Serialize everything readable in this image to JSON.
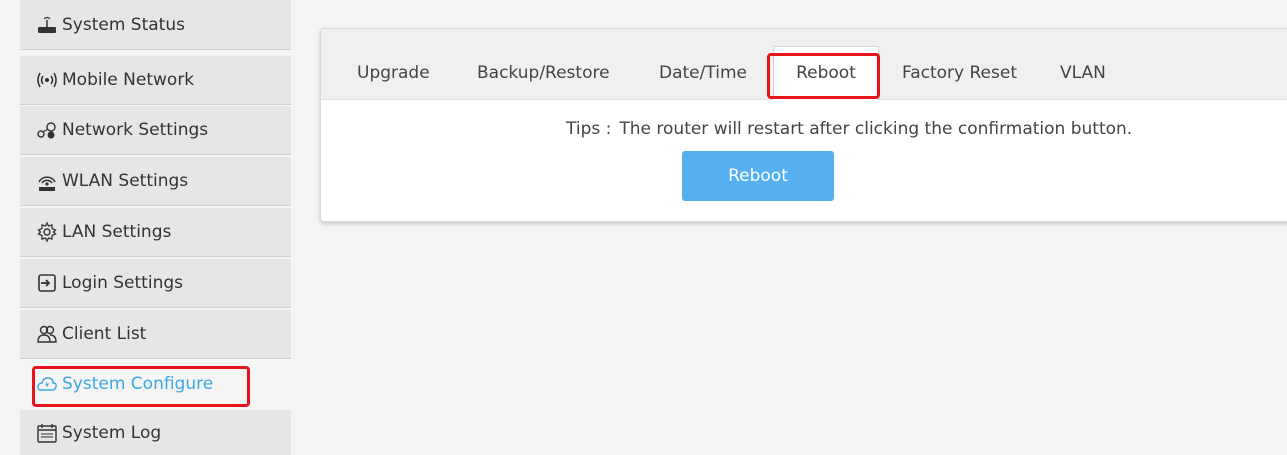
{
  "sidebar": {
    "items": [
      {
        "label": "System Status",
        "icon": "router-icon"
      },
      {
        "label": "Mobile Network",
        "icon": "signal-icon"
      },
      {
        "label": "Network Settings",
        "icon": "network-icon"
      },
      {
        "label": "WLAN Settings",
        "icon": "wifi-icon"
      },
      {
        "label": "LAN Settings",
        "icon": "gear-icon"
      },
      {
        "label": "Login Settings",
        "icon": "login-icon"
      },
      {
        "label": "Client List",
        "icon": "users-icon"
      },
      {
        "label": "System Configure",
        "icon": "cloud-icon",
        "active": true
      },
      {
        "label": "System Log",
        "icon": "calendar-icon"
      }
    ]
  },
  "tabs": [
    {
      "label": "Upgrade"
    },
    {
      "label": "Backup/Restore"
    },
    {
      "label": "Date/Time"
    },
    {
      "label": "Reboot",
      "active": true
    },
    {
      "label": "Factory Reset"
    },
    {
      "label": "VLAN"
    }
  ],
  "content": {
    "tips_label": "Tips :",
    "tips_text": "The router will restart after clicking the confirmation button.",
    "reboot_button": "Reboot"
  },
  "colors": {
    "accent": "#3ea6e3",
    "button": "#55aff0",
    "highlight": "#e8141b"
  }
}
